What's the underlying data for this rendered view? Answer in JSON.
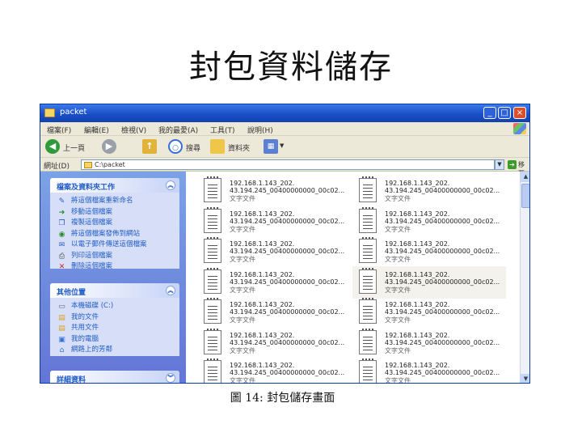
{
  "slide": {
    "title": "封包資料儲存"
  },
  "window": {
    "title": "packet",
    "controls": {
      "minimize": "_",
      "maximize": "□",
      "close": "×"
    }
  },
  "menubar": [
    "檔案(F)",
    "編輯(E)",
    "檢視(V)",
    "我的最愛(A)",
    "工具(T)",
    "說明(H)"
  ],
  "toolbar": {
    "back_label": "上一頁",
    "search_label": "搜尋",
    "folders_label": "資料夾",
    "views_icon": "views-icon"
  },
  "address": {
    "label": "網址(D)",
    "value": "C:\\packet",
    "go_label": "移至"
  },
  "sidebar": {
    "tasks": {
      "title": "檔案及資料夾工作",
      "items": [
        {
          "icon": "rename-icon",
          "label": "將這個檔案重新命名"
        },
        {
          "icon": "move-icon",
          "label": "移動這個檔案"
        },
        {
          "icon": "copy-icon",
          "label": "複製這個檔案"
        },
        {
          "icon": "web-publish-icon",
          "label": "將這個檔案發佈到網站"
        },
        {
          "icon": "email-icon",
          "label": "以電子郵件傳送這個檔案"
        },
        {
          "icon": "print-icon",
          "label": "列印這個檔案"
        },
        {
          "icon": "delete-icon",
          "label": "刪除這個檔案"
        }
      ]
    },
    "places": {
      "title": "其他位置",
      "items": [
        {
          "icon": "drive-icon",
          "label": "本機磁碟 (C:)"
        },
        {
          "icon": "documents-icon",
          "label": "我的文件"
        },
        {
          "icon": "shared-folder-icon",
          "label": "共用文件"
        },
        {
          "icon": "computer-icon",
          "label": "我的電腦"
        },
        {
          "icon": "network-icon",
          "label": "網路上的芳鄰"
        }
      ]
    },
    "details": {
      "title": "詳細資料"
    }
  },
  "files": [
    {
      "line1": "192.168.1.143_202.",
      "line2": "43.194.245_00400000000_00c02...",
      "type": "文字文件"
    },
    {
      "line1": "192.168.1.143_202.",
      "line2": "43.194.245_00400000000_00c02...",
      "type": "文字文件"
    },
    {
      "line1": "192.168.1.143_202.",
      "line2": "43.194.245_00400000000_00c02...",
      "type": "文字文件"
    },
    {
      "line1": "192.168.1.143_202.",
      "line2": "43.194.245_00400000000_00c02...",
      "type": "文字文件"
    },
    {
      "line1": "192.168.1.143_202.",
      "line2": "43.194.245_00400000000_00c02...",
      "type": "文字文件"
    },
    {
      "line1": "192.168.1.143_202.",
      "line2": "43.194.245_00400000000_00c02...",
      "type": "文字文件"
    },
    {
      "line1": "192.168.1.143_202.",
      "line2": "43.194.245_00400000000_00c02...",
      "type": "文字文件"
    },
    {
      "line1": "192.168.1.143_202.",
      "line2": "43.194.245_00400000000_00c02...",
      "type": "文字文件"
    },
    {
      "line1": "192.168.1.143_202.",
      "line2": "43.194.245_00400000000_00c02...",
      "type": "文字文件"
    },
    {
      "line1": "192.168.1.143_202.",
      "line2": "43.194.245_00400000000_00c02...",
      "type": "文字文件"
    },
    {
      "line1": "192.168.1.143_202.",
      "line2": "43.194.245_00400000000_00c02...",
      "type": "文字文件"
    },
    {
      "line1": "192.168.1.143_202.",
      "line2": "43.194.245_00400000000_00c02...",
      "type": "文字文件"
    },
    {
      "line1": "192.168.1.143_202.",
      "line2": "43.194.245_00400000000_00c02...",
      "type": "文字文件"
    },
    {
      "line1": "192.168.1.143_202.",
      "line2": "43.194.245_00400000000_00c02...",
      "type": "文字文件"
    }
  ],
  "selected_file_index": 7,
  "caption": "圖 14: 封包儲存畫面",
  "colors": {
    "titlebar": "#1a4fc8",
    "sidebar": "#6f8fe0",
    "link": "#215dc6"
  }
}
